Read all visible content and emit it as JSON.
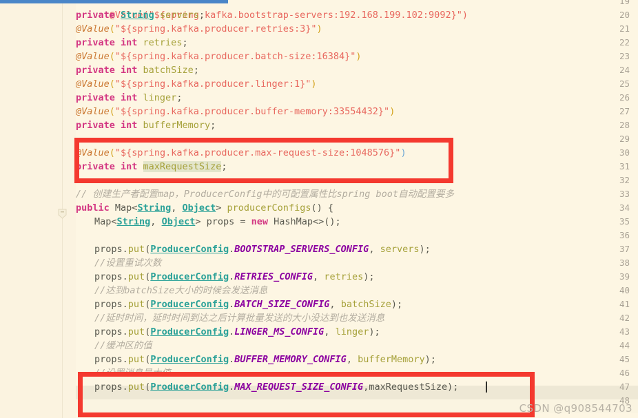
{
  "editor": {
    "background_color": "#fdf6e3",
    "gutter_color": "#fbf3e0",
    "highlight_row_color": "#eee8d5",
    "selection_bar_color": "#4a86c8",
    "annotation_box_color": "#f4392f",
    "caret_color": "#33332e",
    "first_visible_line": 19,
    "last_visible_line": 48,
    "current_line": 47
  },
  "line_numbers": [
    "19",
    "20",
    "21",
    "22",
    "23",
    "24",
    "25",
    "26",
    "27",
    "28",
    "29",
    "30",
    "31",
    "32",
    "33",
    "34",
    "35",
    "36",
    "37",
    "38",
    "39",
    "40",
    "41",
    "42",
    "43",
    "44",
    "45",
    "46",
    "47",
    "48"
  ],
  "lines": {
    "l19": "@Value(\"${spring.kafka.bootstrap-servers:192.168.199.102:9092}\")",
    "l20_kw": "private",
    "l20_type": "String",
    "l20_name": "servers",
    "l21_anno": "@Value",
    "l21_str": "\"${spring.kafka.producer.retries:3}\"",
    "l22_kw": "private int",
    "l22_name": "retries",
    "l23_anno": "@Value",
    "l23_str": "\"${spring.kafka.producer.batch-size:16384}\"",
    "l24_kw": "private int",
    "l24_name": "batchSize",
    "l25_anno": "@Value",
    "l25_str": "\"${spring.kafka.producer.linger:1}\"",
    "l26_kw": "private int",
    "l26_name": "linger",
    "l27_anno": "@Value",
    "l27_str": "\"${spring.kafka.producer.buffer-memory:33554432}\"",
    "l28_kw": "private int",
    "l28_name": "bufferMemory",
    "l30_anno": "@Value",
    "l30_str": "\"${spring.kafka.producer.max-request-size:1048576}\"",
    "l31_kw": "private int",
    "l31_name": "maxRequestSize",
    "l33_comment": "// 创建生产者配置map，ProducerConfig中的可配置属性比spring boot自动配置要多",
    "l34_kw": "public",
    "l34_map": "Map<",
    "l34_t1": "String",
    "l34_comma": ", ",
    "l34_t2": "Object",
    "l34_gt": "> ",
    "l34_method": "producerConfigs",
    "l34_tail": "() {",
    "l35_map": "Map<",
    "l35_t1": "String",
    "l35_comma": ", ",
    "l35_t2": "Object",
    "l35_gt": "> props = ",
    "l35_new": "new",
    "l35_tail": " HashMap<>();",
    "l37_pre": "props.",
    "l37_put": "put",
    "l37_cls": "ProducerConfig",
    "l37_const": "BOOTSTRAP_SERVERS_CONFIG",
    "l37_arg": "servers",
    "l38_comment": "//设置重试次数",
    "l39_pre": "props.",
    "l39_put": "put",
    "l39_cls": "ProducerConfig",
    "l39_const": "RETRIES_CONFIG",
    "l39_arg": "retries",
    "l40_comment": "//达到batchSize大小的时候会发送消息",
    "l41_pre": "props.",
    "l41_put": "put",
    "l41_cls": "ProducerConfig",
    "l41_const": "BATCH_SIZE_CONFIG",
    "l41_arg": "batchSize",
    "l42_comment": "//延时时间，延时时间到达之后计算批量发送的大小没达到也发送消息",
    "l43_pre": "props.",
    "l43_put": "put",
    "l43_cls": "ProducerConfig",
    "l43_const": "LINGER_MS_CONFIG",
    "l43_arg": "linger",
    "l44_comment": "//缓冲区的值",
    "l45_pre": "props.",
    "l45_put": "put",
    "l45_cls": "ProducerConfig",
    "l45_const": "BUFFER_MEMORY_CONFIG",
    "l45_arg": "bufferMemory",
    "l46_comment": "//设置消息最大值",
    "l47_pre": "props.",
    "l47_put": "put",
    "l47_cls": "ProducerConfig",
    "l47_const": "MAX_REQUEST_SIZE_CONFIG",
    "l47_arg": "maxRequestSize"
  },
  "watermark": {
    "text": "CSDN @q908544703"
  }
}
